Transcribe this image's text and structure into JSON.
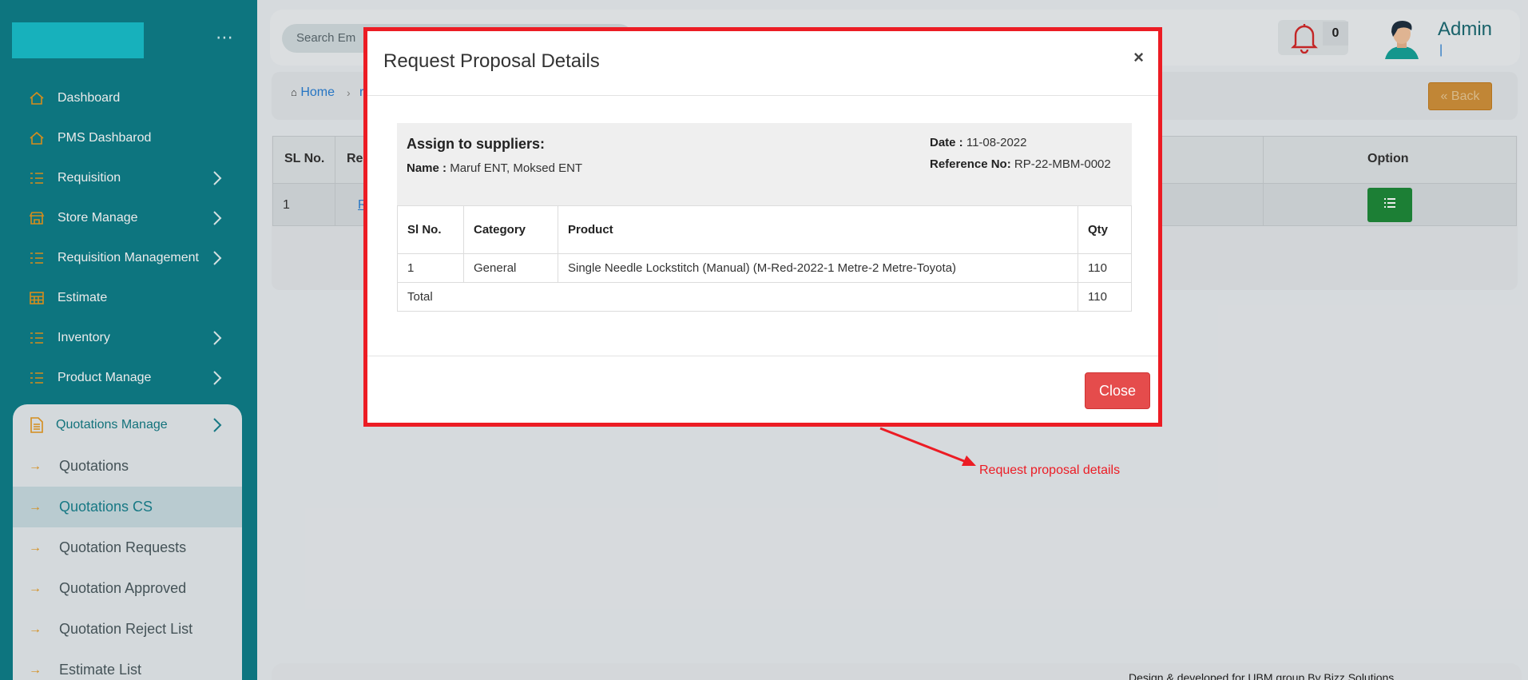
{
  "sidebar": {
    "nav": [
      {
        "label": "Dashboard",
        "icon": "home-icon",
        "has_chevron": false
      },
      {
        "label": "PMS Dashbarod",
        "icon": "home-icon",
        "has_chevron": false
      },
      {
        "label": "Requisition",
        "icon": "list-icon",
        "has_chevron": true
      },
      {
        "label": "Store Manage",
        "icon": "store-icon",
        "has_chevron": true
      },
      {
        "label": "Requisition Management",
        "icon": "list-icon",
        "has_chevron": true
      },
      {
        "label": "Estimate",
        "icon": "calculator-icon",
        "has_chevron": false
      },
      {
        "label": "Inventory",
        "icon": "list-icon",
        "has_chevron": true
      },
      {
        "label": "Product Manage",
        "icon": "list-icon",
        "has_chevron": true
      }
    ],
    "submenu": {
      "title": "Quotations Manage",
      "items": [
        {
          "label": "Quotations",
          "active": false
        },
        {
          "label": "Quotations CS",
          "active": true
        },
        {
          "label": "Quotation Requests",
          "active": false
        },
        {
          "label": "Quotation Approved",
          "active": false
        },
        {
          "label": "Quotation Reject List",
          "active": false
        },
        {
          "label": "Estimate List",
          "active": false
        }
      ]
    },
    "menu_dots": "⋯"
  },
  "header": {
    "search_placeholder": "Search Em",
    "notification_count": "0",
    "user_name": "Admin",
    "user_sub": "|"
  },
  "breadcrumb": {
    "home": "Home",
    "next": "r"
  },
  "back_button": "Back",
  "background_table": {
    "headers": [
      "SL No.",
      "Re",
      "Option"
    ],
    "row": {
      "sl": "1",
      "ref": "R"
    }
  },
  "footer_text": "Design & developed for UBM group By Bizz Solutions",
  "modal": {
    "title": "Request Proposal Details",
    "close_x": "×",
    "assign_label": "Assign to suppliers:",
    "name_label": "Name :",
    "name_value": "Maruf ENT, Moksed ENT",
    "date_label": "Date :",
    "date_value": "11-08-2022",
    "ref_label": "Reference No:",
    "ref_value": "RP-22-MBM-0002",
    "table": {
      "headers": [
        "Sl No.",
        "Category",
        "Product",
        "Qty"
      ],
      "rows": [
        {
          "sl": "1",
          "category": "General",
          "product": "Single Needle Lockstitch (Manual) (M-Red-2022-1 Metre-2 Metre-Toyota)",
          "qty": "110"
        }
      ],
      "total_label": "Total",
      "total_value": "110"
    },
    "close_button": "Close"
  },
  "annotation": {
    "text": "Request proposal details",
    "color": "#ec1c24"
  },
  "colors": {
    "sidebar": "#0f7f8a",
    "accent_orange": "#e89a1f",
    "modal_border": "#ec1c24",
    "close_button": "#e54c4c",
    "option_button": "#1f8a3a"
  }
}
